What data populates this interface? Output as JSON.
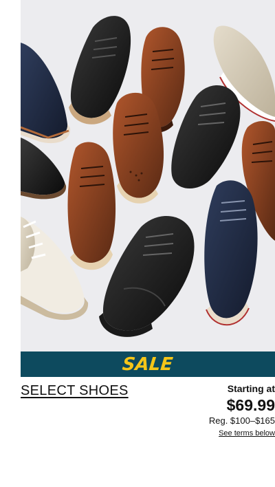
{
  "promo": {
    "banner_label": "SALE",
    "category_link": "SELECT SHOES",
    "starting_label": "Starting at",
    "sale_price": "$69.99",
    "regular_price": "Reg. $100–$165",
    "terms_link": "See terms below"
  },
  "colors": {
    "banner_bg": "#0d4a5e",
    "banner_text": "#f5c518",
    "hero_bg": "#ececef"
  }
}
